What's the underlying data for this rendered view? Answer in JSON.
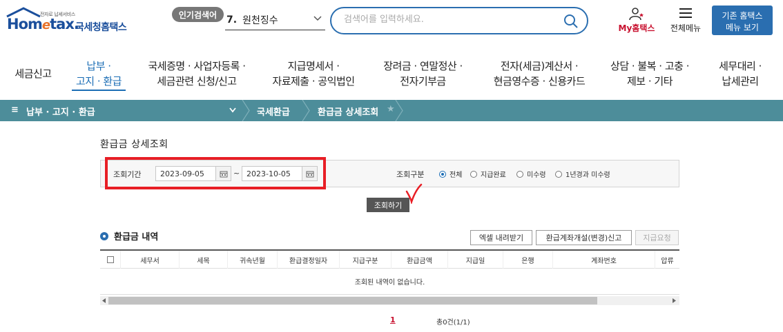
{
  "header": {
    "logo_tagline": "전자로 납세서비스",
    "logo_text_hom": "Hom",
    "logo_text_e": "e",
    "logo_text_tax": "tax.",
    "logo_kor": "국세청홈택스",
    "hot_search_badge": "인기검색어",
    "hot_search_num": "7.",
    "hot_search_value": "원천징수",
    "search_placeholder": "검색어를 입력하세요.",
    "my_hometax": "My홈택스",
    "all_menu": "전체메뉴",
    "legacy_line1": "기존 홈택스",
    "legacy_line2": "메뉴 보기"
  },
  "main_menu": [
    {
      "label": "세금신고"
    },
    {
      "label": "납부 ·\n고지 · 환급"
    },
    {
      "label": "국세증명 · 사업자등록 ·\n세금관련 신청/신고"
    },
    {
      "label": "지급명세서 ·\n자료제출 · 공익법인"
    },
    {
      "label": "장려금 · 연말정산 ·\n전자기부금"
    },
    {
      "label": "전자(세금)계산서 ·\n현금영수증 · 신용카드"
    },
    {
      "label": "상담 · 불복 · 고충 ·\n제보 · 기타"
    },
    {
      "label": "세무대리 ·\n납세관리"
    }
  ],
  "breadcrumb": {
    "root": "납부 · 고지 · 환급",
    "level2": "국세환급",
    "level3": "환급금 상세조회"
  },
  "page_title": "환급금 상세조회",
  "filter": {
    "period_label": "조회기간",
    "start_date": "2023-09-05",
    "tilde": "~",
    "end_date": "2023-10-05",
    "type_label": "조회구분",
    "options": [
      "전체",
      "지급완료",
      "미수령",
      "1년경과 미수령"
    ],
    "selected": "전체",
    "query_button": "조회하기"
  },
  "result": {
    "section_title": "환급금 내역",
    "excel_button": "엑셀 내려받기",
    "account_button": "환급계좌개설(변경)신고",
    "request_button": "지급요청",
    "columns": [
      "세무서",
      "세목",
      "귀속년월",
      "환급결정일자",
      "지급구분",
      "환급금액",
      "지급일",
      "은행",
      "계좌번호",
      "압류"
    ],
    "empty_message": "조회된 내역이 없습니다.",
    "page": "1",
    "total": "총0건(1/1)"
  },
  "colors": {
    "brand_blue": "#1b4f9c",
    "accent_blue": "#2a6eb0",
    "crumb_bar": "#4d8d9a",
    "highlight_red": "#e81e25"
  }
}
